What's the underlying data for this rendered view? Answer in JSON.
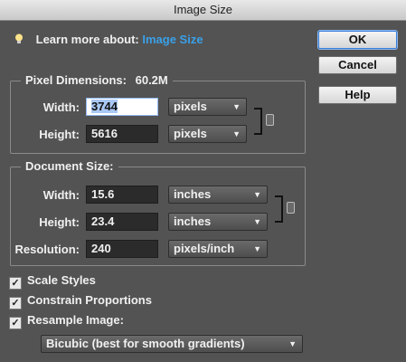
{
  "window": {
    "title": "Image Size"
  },
  "learn": {
    "prefix": "Learn more about:",
    "link": "Image Size"
  },
  "buttons": {
    "ok": "OK",
    "cancel": "Cancel",
    "help": "Help"
  },
  "pixel_dimensions": {
    "title": "Pixel Dimensions:",
    "size": "60.2M",
    "width_label": "Width:",
    "width_value": "3744",
    "width_unit": "pixels",
    "height_label": "Height:",
    "height_value": "5616",
    "height_unit": "pixels"
  },
  "document_size": {
    "title": "Document Size:",
    "width_label": "Width:",
    "width_value": "15.6",
    "width_unit": "inches",
    "height_label": "Height:",
    "height_value": "23.4",
    "height_unit": "inches",
    "resolution_label": "Resolution:",
    "resolution_value": "240",
    "resolution_unit": "pixels/inch"
  },
  "options": {
    "scale_styles": {
      "label": "Scale Styles",
      "checked": true
    },
    "constrain_proportions": {
      "label": "Constrain Proportions",
      "checked": true
    },
    "resample_image": {
      "label": "Resample Image:",
      "checked": true
    }
  },
  "resample_method": "Bicubic (best for smooth gradients)",
  "icons": [
    "lightbulb-icon",
    "link-chain-icon",
    "dropdown-arrow-icon",
    "checkmark-icon"
  ],
  "colors": {
    "background": "#535353",
    "link": "#3aa0e8",
    "field": "#2b2b2b"
  }
}
